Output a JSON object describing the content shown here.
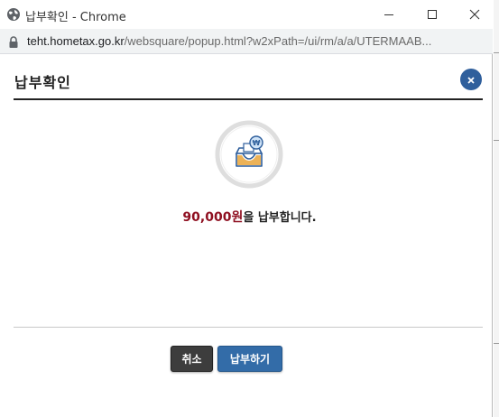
{
  "window": {
    "title": "납부확인 - Chrome",
    "url_host": "teht.hometax.go.kr",
    "url_path": "/websquare/popup.html?w2xPath=/ui/rm/a/a/UTERMAAB..."
  },
  "dialog": {
    "title": "납부확인",
    "message_amount": "90,000원",
    "message_suffix": "을 납부합니다.",
    "cancel_label": "취소",
    "pay_label": "납부하기"
  },
  "colors": {
    "accent": "#336ca8",
    "close_button": "#2f5f9c",
    "amount": "#8f1021",
    "cancel_button": "#3d3d3d"
  }
}
